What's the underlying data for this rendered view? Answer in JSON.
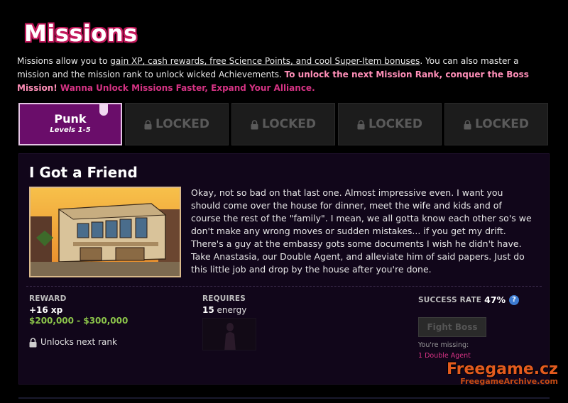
{
  "page": {
    "title": "Missions"
  },
  "intro": {
    "text_1": "Missions allow you to ",
    "underlined": "gain XP, cash rewards, free Science Points, and cool Super-Item bonuses",
    "text_2": ". You can also master a mission and the mission rank to unlock wicked Achievements. ",
    "bold_pink": "To unlock the next Mission Rank, conquer the Boss Mission!",
    "magenta": " Wanna Unlock Missions Faster, Expand Your Alliance."
  },
  "tabs": [
    {
      "label": "Punk",
      "sub": "Levels 1-5",
      "active": true
    },
    {
      "label": "LOCKED",
      "active": false
    },
    {
      "label": "LOCKED",
      "active": false
    },
    {
      "label": "LOCKED",
      "active": false
    },
    {
      "label": "LOCKED",
      "active": false
    }
  ],
  "mission": {
    "title": "I Got a Friend",
    "description": "Okay, not so bad on that last one. Almost impressive even. I want you should come over the house for dinner, meet the wife and kids and of course the rest of the \"family\". I mean, we all gotta know each other so's we don't make any wrong moves or sudden mistakes... if you get my drift. There's a guy at the embassy gots some documents I wish he didn't have. Take Anastasia, our Double Agent, and alleviate him of said papers. Just do this little job and drop by the house after you're done."
  },
  "reward": {
    "label": "REWARD",
    "xp": "+16 xp",
    "cash": "$200,000 - $300,000",
    "unlock": "Unlocks next rank"
  },
  "requires": {
    "label": "REQUIRES",
    "energy_value": "15",
    "energy_unit": " energy"
  },
  "success": {
    "label": "SUCCESS RATE",
    "rate": "47%",
    "button": "Fight Boss",
    "missing_label": "You're missing:",
    "missing_item": "1 Double Agent"
  },
  "watermark": {
    "main": "Freegame.cz",
    "sub": "FreegameArchive.com"
  },
  "colors": {
    "accent": "#6a0d6a",
    "pink": "#d63384",
    "cash": "#8bc34a",
    "panel": "#11061a"
  },
  "icons": {
    "lock": "lock-icon",
    "help": "help-icon",
    "pin": "pin-icon"
  }
}
